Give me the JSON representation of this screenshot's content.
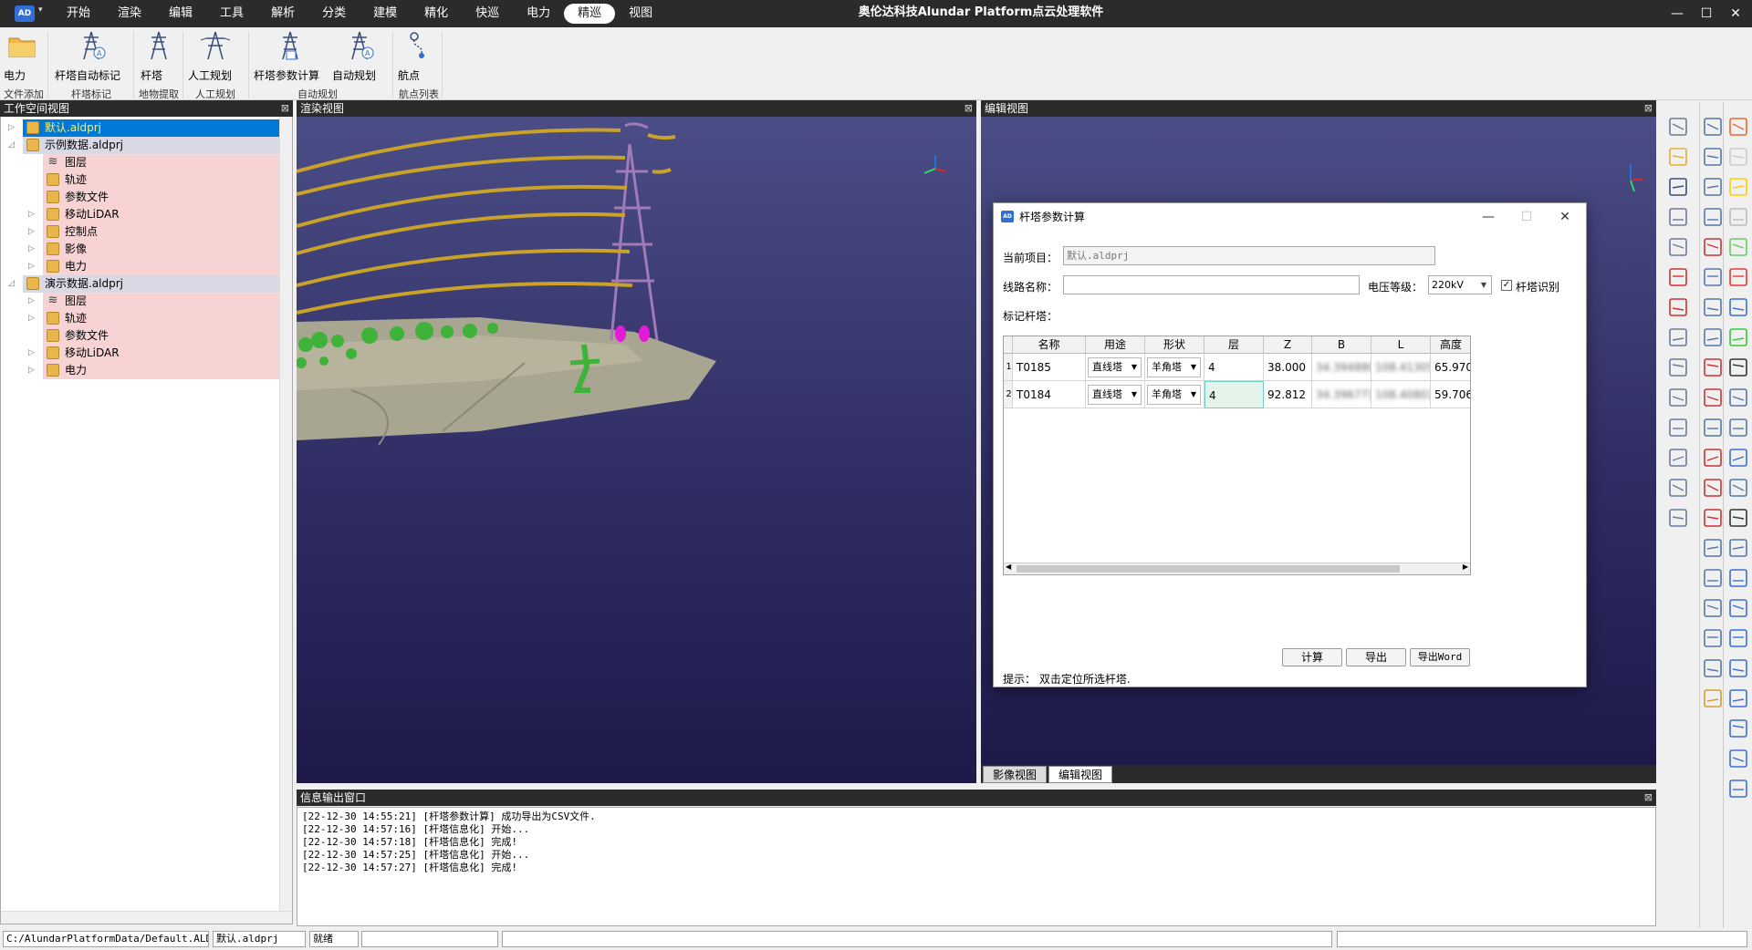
{
  "titlebar": {
    "app_title": "奥伦达科技Alundar Platform点云处理软件",
    "logo_text": "AD",
    "menu_tabs": [
      "开始",
      "渲染",
      "编辑",
      "工具",
      "解析",
      "分类",
      "建模",
      "精化",
      "快巡",
      "电力",
      "精巡",
      "视图"
    ],
    "active_tab": "精巡"
  },
  "ribbon": {
    "buttons": [
      {
        "label": "电力",
        "icon": "folder-icon"
      },
      {
        "label": "杆塔自动标记",
        "icon": "tower-auto-mark-icon"
      },
      {
        "label": "杆塔",
        "icon": "tower-icon"
      },
      {
        "label": "人工规划",
        "icon": "manual-plan-icon"
      },
      {
        "label": "杆塔参数计算",
        "icon": "tower-param-icon"
      },
      {
        "label": "自动规划",
        "icon": "auto-plan-icon"
      },
      {
        "label": "航点",
        "icon": "waypoint-icon"
      }
    ],
    "groups": [
      "文件添加",
      "杆塔标记",
      "地物提取",
      "人工规划",
      "自动规划",
      "航点列表"
    ]
  },
  "workspace": {
    "title": "工作空间视图",
    "items": [
      {
        "label": "默认.aldprj",
        "level": 0,
        "expander": "▷",
        "selected": true
      },
      {
        "label": "示例数据.aldprj",
        "level": 0,
        "expander": "◿",
        "project": true
      },
      {
        "label": "图层",
        "level": 1,
        "expander": "",
        "icon": "layers"
      },
      {
        "label": "轨迹",
        "level": 1,
        "expander": "",
        "icon": "folder"
      },
      {
        "label": "参数文件",
        "level": 1,
        "expander": "",
        "icon": "folder"
      },
      {
        "label": "移动LiDAR",
        "level": 1,
        "expander": "▷",
        "icon": "folder"
      },
      {
        "label": "控制点",
        "level": 1,
        "expander": "▷",
        "icon": "folder"
      },
      {
        "label": "影像",
        "level": 1,
        "expander": "▷",
        "icon": "folder"
      },
      {
        "label": "电力",
        "level": 1,
        "expander": "▷",
        "icon": "folder"
      },
      {
        "label": "演示数据.aldprj",
        "level": 0,
        "expander": "◿",
        "project": true
      },
      {
        "label": "图层",
        "level": 1,
        "expander": "▷",
        "icon": "layers"
      },
      {
        "label": "轨迹",
        "level": 1,
        "expander": "▷",
        "icon": "folder"
      },
      {
        "label": "参数文件",
        "level": 1,
        "expander": "",
        "icon": "folder"
      },
      {
        "label": "移动LiDAR",
        "level": 1,
        "expander": "▷",
        "icon": "folder"
      },
      {
        "label": "电力",
        "level": 1,
        "expander": "▷",
        "icon": "folder"
      }
    ]
  },
  "render_view": {
    "title": "渲染视图"
  },
  "edit_view": {
    "title": "编辑视图"
  },
  "bottom_tabs": {
    "tab1": "影像视图",
    "tab2": "编辑视图"
  },
  "dialog": {
    "title": "杆塔参数计算",
    "project_label": "当前项目：",
    "project_value": "默认.aldprj",
    "line_name_label": "线路名称：",
    "line_name_value": "",
    "voltage_label": "电压等级：",
    "voltage_value": "220kV",
    "tower_recog_label": "杆塔识别",
    "tower_recog_checked": "✓",
    "marked_label": "标记杆塔：",
    "columns": [
      "名称",
      "用途",
      "形状",
      "层",
      "Z",
      "B",
      "L",
      "高度"
    ],
    "rows": [
      {
        "idx": "1",
        "name": "T0185",
        "use": "直线塔",
        "shape": "羊角塔",
        "layer": "4",
        "z": "38.000",
        "b": "34.3948800",
        "l": "108.4130500",
        "h": "65.970"
      },
      {
        "idx": "2",
        "name": "T0184",
        "use": "直线塔",
        "shape": "羊角塔",
        "layer": "4",
        "z": "92.812",
        "b": "34.3967718",
        "l": "108.4080147",
        "h": "59.706"
      }
    ],
    "btn_calc": "计算",
    "btn_export": "导出",
    "btn_export_word": "导出Word",
    "hint": "提示：  双击定位所选杆塔."
  },
  "output": {
    "title": "信息输出窗口",
    "lines": [
      "[22-12-30 14:55:21] [杆塔参数计算] 成功导出为CSV文件.",
      "[22-12-30 14:57:16] [杆塔信息化] 开始...",
      "[22-12-30 14:57:18] [杆塔信息化] 完成!",
      "[22-12-30 14:57:25] [杆塔信息化] 开始...",
      "[22-12-30 14:57:27] [杆塔信息化] 完成!"
    ]
  },
  "statusbar": {
    "path": "C:/AlundarPlatformData/Default.ALDWS",
    "project": "默认.aldprj",
    "status": "就绪"
  },
  "colors": {
    "accent": "#0078d7",
    "project_bg": "#f7d3d3",
    "selected_bg": "#0078d7",
    "viewport_top": "#4b4d86",
    "viewport_bottom": "#1d1a4a"
  }
}
